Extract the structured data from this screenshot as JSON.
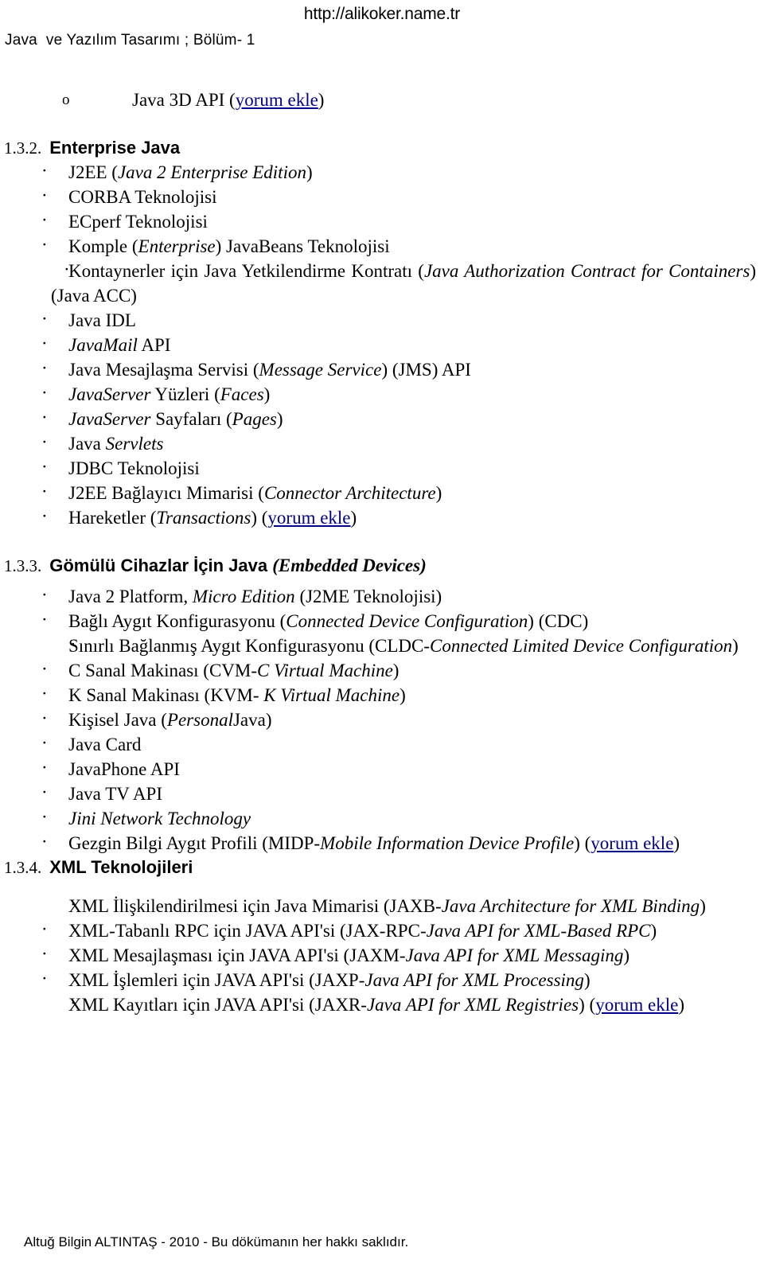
{
  "header": {
    "site_url": "http://alikoker.name.tr",
    "doc_title": "Java  ve Yazılım Tasarımı ; Bölüm- 1"
  },
  "top_item": {
    "bullet": "o",
    "text_before": "Java 3D API (",
    "link": "yorum ekle",
    "text_after": ")"
  },
  "sections": [
    {
      "number": "1.3.2.",
      "title": "Enterprise Java",
      "title_italic": "",
      "items": [
        "J2EE (Java 2 Enterprise Edition)",
        "CORBA Teknolojisi",
        "ECperf Teknolojisi",
        "Komple (Enterprise) JavaBeans Teknolojisi",
        "Kontaynerler için Java Yetkilendirme Kontratı (Java Authorization Contract for Containers) (Java ACC)",
        "Java IDL",
        "JavaMail API",
        "Java Mesajlaşma Servisi (Message Service) (JMS) API",
        "JavaServer Yüzleri (Faces)",
        "JavaServer Sayfaları (Pages)",
        "Java Servlets",
        "JDBC Teknolojisi",
        "J2EE Bağlayıcı Mimarisi (Connector Architecture)",
        "Hareketler (Transactions) (yorum ekle)"
      ]
    },
    {
      "number": "1.3.3.",
      "title": "Gömülü Cihazlar İçin Java ",
      "title_italic": "(Embedded Devices)",
      "items": [
        "Java 2 Platform, Micro Edition (J2ME Teknolojisi)",
        "Bağlı Aygıt Konfigurasyonu (Connected Device Configuration) (CDC)",
        "Sınırlı Bağlanmış Aygıt Konfigurasyonu (CLDC-Connected Limited Device Configuration)",
        "C Sanal Makinası (CVM-C Virtual Machine)",
        "K Sanal Makinası  (KVM- K Virtual Machine)",
        "Kişisel Java (PersonalJava)",
        "Java Card",
        "JavaPhone API",
        "Java TV API",
        "Jini Network Technology",
        "Gezgin Bilgi Aygıt Profili (MIDP-Mobile Information Device Profile)  (yorum ekle)"
      ]
    },
    {
      "number": "1.3.4.",
      "title": "XML Teknolojileri",
      "title_italic": "",
      "items": [
        "XML İlişkilendirilmesi için Java Mimarisi (JAXB-Java Architecture for XML Binding)",
        "XML-Tabanlı RPC için JAVA API'si (JAX-RPC-Java API for XML-Based RPC)",
        "XML Mesajlaşması için JAVA API'si (JAXM-Java API for XML Messaging)",
        "XML İşlemleri için JAVA API'si  (JAXP-Java API for XML Processing)",
        "XML Kayıtları için JAVA API'si (JAXR-Java API for XML Registries) (yorum ekle)"
      ]
    }
  ],
  "s2": {
    "i0_a": "J2EE (",
    "i0_b": "Java 2 Enterprise Edition",
    "i0_c": ")",
    "i1": "CORBA Teknolojisi",
    "i2": "ECperf Teknolojisi",
    "i3_a": "Komple (",
    "i3_b": "Enterprise",
    "i3_c": ") JavaBeans Teknolojisi",
    "i4_a": "Kontaynerler için Java Yetkilendirme Kontratı (",
    "i4_b": "Java Authorization Contract for  Containers",
    "i4_c": ") (Java ACC)",
    "i5": "Java IDL",
    "i6_a": "JavaMail",
    "i6_b": " API",
    "i7_a": "Java Mesajlaşma Servisi (",
    "i7_b": "Message Service",
    "i7_c": ") (JMS) API",
    "i8_a": "JavaServer",
    "i8_b": " Yüzleri (",
    "i8_c": "Faces",
    "i8_d": ")",
    "i9_a": "JavaServer",
    "i9_b": " Sayfaları (",
    "i9_c": "Pages",
    "i9_d": ")",
    "i10_a": "Java ",
    "i10_b": "Servlets",
    "i11": "JDBC Teknolojisi",
    "i12_a": "J2EE Bağlayıcı Mimarisi (",
    "i12_b": "Connector Architecture",
    "i12_c": ")",
    "i13_a": "Hareketler (",
    "i13_b": "Transactions",
    "i13_c": ") (",
    "i13_link": "yorum ekle",
    "i13_d": ")"
  },
  "s3": {
    "i0_a": "Java 2 Platform, ",
    "i0_b": "Micro Edition",
    "i0_c": " (J2ME Teknolojisi)",
    "i1_a": "Bağlı Aygıt Konfigurasyonu (",
    "i1_b": "Connected Device Configuration",
    "i1_c": ") (CDC)",
    "i2_a": "Sınırlı Bağlanmış Aygıt Konfigurasyonu (CLDC-",
    "i2_b": "Connected Limited Device Configuration",
    "i2_c": ")",
    "i3_a": "C Sanal Makinası (CVM-",
    "i3_b": "C Virtual Machine",
    "i3_c": ")",
    "i4_a": "K Sanal Makinası  (KVM- ",
    "i4_b": "K Virtual Machine",
    "i4_c": ")",
    "i5_a": "Kişisel Java (",
    "i5_b": "Personal",
    "i5_c": "Java)",
    "i6": "Java Card",
    "i7": "JavaPhone API",
    "i8": "Java TV API",
    "i9": "Jini Network Technology",
    "i10_a": "Gezgin Bilgi Aygıt Profili (MIDP-",
    "i10_b": "Mobile Information Device Profile",
    "i10_c": ")  (",
    "i10_link": "yorum ekle",
    "i10_d": ")"
  },
  "s4": {
    "i0_a": "XML İlişkilendirilmesi için Java Mimarisi (JAXB-",
    "i0_b": "Java Architecture for XML Binding",
    "i0_c": ")",
    "i1_a": "XML-Tabanlı RPC için JAVA API'si (JAX-RPC-",
    "i1_b": "Java API for XML-Based RPC",
    "i1_c": ")",
    "i2_a": "XML Mesajlaşması için JAVA API'si (JAXM-",
    "i2_b": "Java API for XML Messaging",
    "i2_c": ")",
    "i3_a": "XML İşlemleri için JAVA API'si  (JAXP-",
    "i3_b": "Java API for XML Processing",
    "i3_c": ")",
    "i4_a": "XML Kayıtları için JAVA API'si (JAXR-",
    "i4_b": "Java API for XML Registries",
    "i4_c": ") (",
    "i4_link": "yorum ekle",
    "i4_d": ")"
  },
  "footer": {
    "text": "Altuğ Bilgin ALTINTAŞ - 2010 - Bu dökümanın her hakkı saklıdır."
  },
  "colors": {
    "link": "#00008B",
    "text": "#000000",
    "background": "#FFFFFF"
  }
}
